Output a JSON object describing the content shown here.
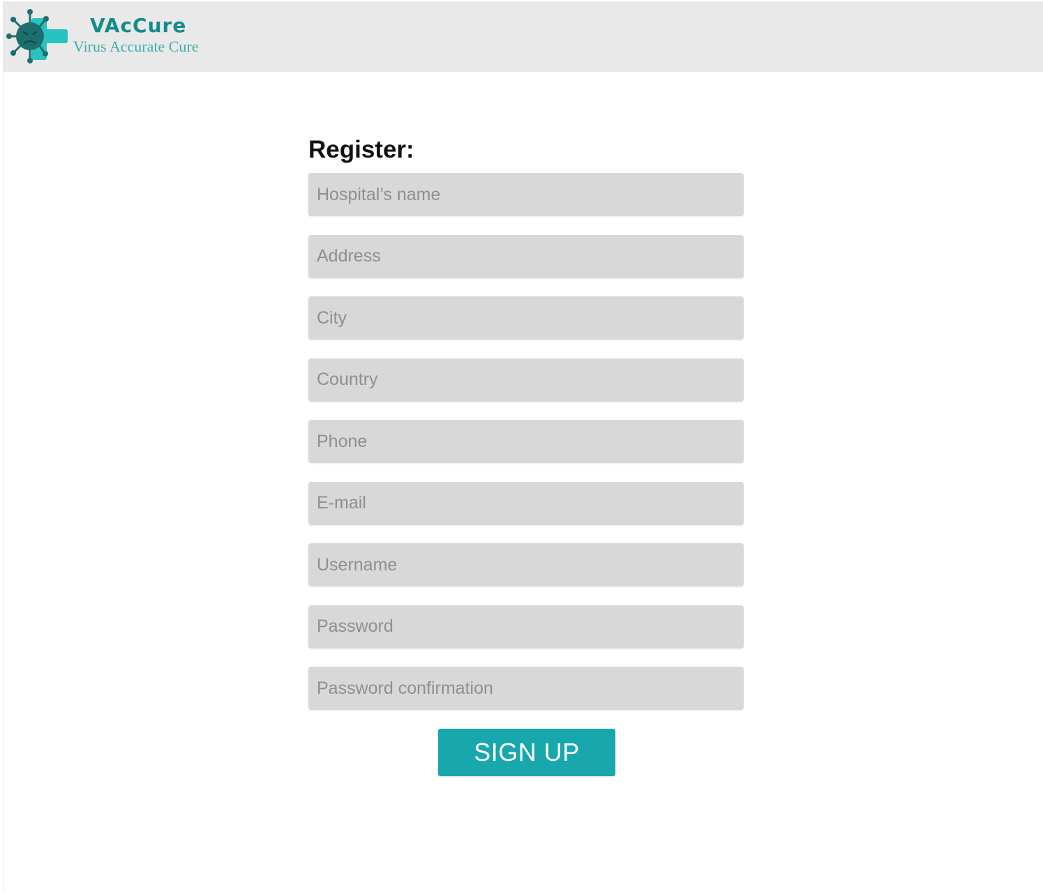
{
  "header": {
    "brand_name": "VAcCure",
    "brand_tagline": "Virus Accurate Cure",
    "logo_icon": "virus-cross-logo-icon"
  },
  "colors": {
    "accent": "#17a7ad",
    "brand_dark": "#148c8a",
    "brand_light": "#3fb0ad",
    "header_bg": "#e9e9e9",
    "field_bg": "#d8d8d8"
  },
  "form": {
    "title": "Register:",
    "fields": [
      {
        "name": "hospital_name",
        "placeholder": "Hospital’s name",
        "value": ""
      },
      {
        "name": "address",
        "placeholder": "Address",
        "value": ""
      },
      {
        "name": "city",
        "placeholder": "City",
        "value": ""
      },
      {
        "name": "country",
        "placeholder": "Country",
        "value": ""
      },
      {
        "name": "phone",
        "placeholder": "Phone",
        "value": ""
      },
      {
        "name": "email",
        "placeholder": "E-mail",
        "value": ""
      },
      {
        "name": "username",
        "placeholder": "Username",
        "value": ""
      },
      {
        "name": "password",
        "placeholder": "Password",
        "value": ""
      },
      {
        "name": "password_confirmation",
        "placeholder": "Password confirmation",
        "value": ""
      }
    ],
    "submit_label": "SIGN UP"
  }
}
